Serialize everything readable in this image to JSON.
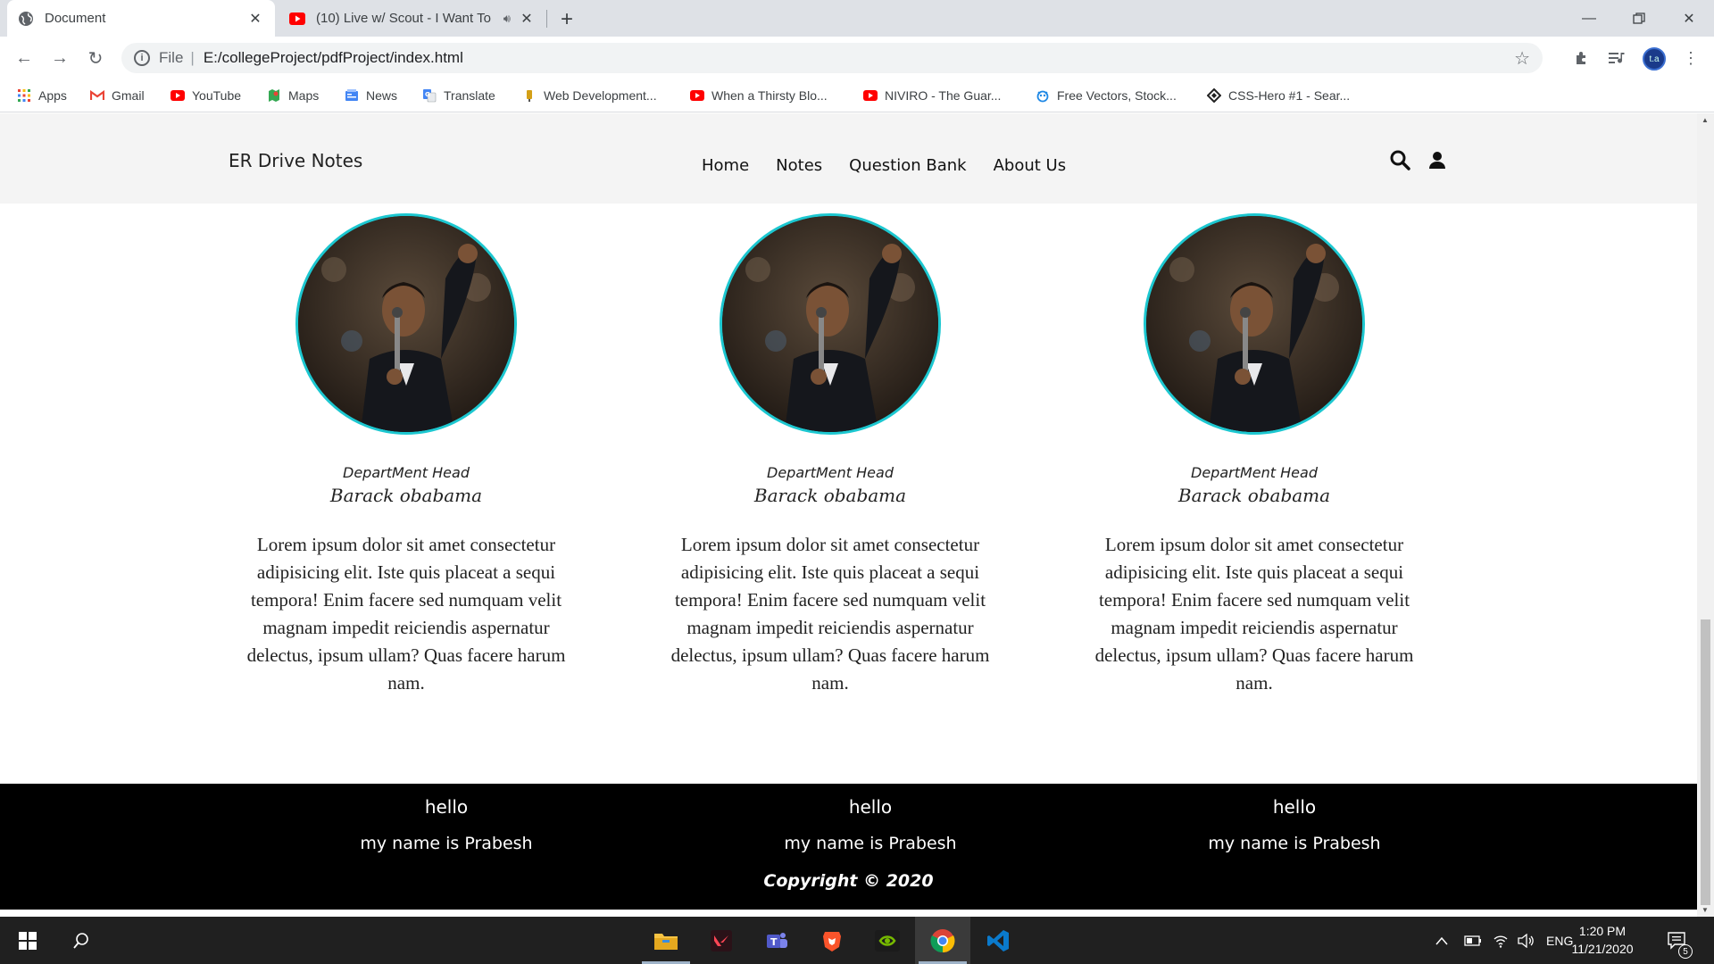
{
  "browser": {
    "tabs": [
      {
        "title": "Document",
        "active": true
      },
      {
        "title": "(10) Live w/ Scout - I Want To",
        "active": false
      }
    ],
    "url_scheme": "File",
    "url": "E:/collegeProject/pdfProject/index.html",
    "bookmarks": [
      {
        "label": "Apps",
        "icon": "apps-grid-icon"
      },
      {
        "label": "Gmail",
        "icon": "gmail-icon"
      },
      {
        "label": "YouTube",
        "icon": "youtube-icon"
      },
      {
        "label": "Maps",
        "icon": "maps-icon"
      },
      {
        "label": "News",
        "icon": "news-icon"
      },
      {
        "label": "Translate",
        "icon": "translate-icon"
      },
      {
        "label": "Web Development...",
        "icon": "web-dev-icon"
      },
      {
        "label": "When a Thirsty Blo...",
        "icon": "youtube-icon"
      },
      {
        "label": "NIVIRO - The Guar...",
        "icon": "youtube-icon"
      },
      {
        "label": "Free Vectors, Stock...",
        "icon": "vectors-icon"
      },
      {
        "label": "CSS-Hero #1 - Sear...",
        "icon": "csshero-icon"
      }
    ],
    "profile_initials": "t.a"
  },
  "site": {
    "brand": "ER Drive Notes",
    "nav": [
      "Home",
      "Notes",
      "Question Bank",
      "About Us"
    ],
    "team": [
      {
        "role": "DepartMent Head",
        "name": "Barack obabama",
        "bio": "Lorem ipsum dolor sit amet consectetur adipisicing elit. Iste quis placeat a sequi tempora! Enim facere sed numquam velit magnam impedit reiciendis aspernatur delectus, ipsum ullam? Quas facere harum nam."
      },
      {
        "role": "DepartMent Head",
        "name": "Barack obabama",
        "bio": "Lorem ipsum dolor sit amet consectetur adipisicing elit. Iste quis placeat a sequi tempora! Enim facere sed numquam velit magnam impedit reiciendis aspernatur delectus, ipsum ullam? Quas facere harum nam."
      },
      {
        "role": "DepartMent Head",
        "name": "Barack obabama",
        "bio": "Lorem ipsum dolor sit amet consectetur adipisicing elit. Iste quis placeat a sequi tempora! Enim facere sed numquam velit magnam impedit reiciendis aspernatur delectus, ipsum ullam? Quas facere harum nam."
      }
    ],
    "footer": {
      "columns": [
        {
          "heading": "hello",
          "text": "my name is Prabesh"
        },
        {
          "heading": "hello",
          "text": "my name is Prabesh"
        },
        {
          "heading": "hello",
          "text": "my name is Prabesh"
        }
      ],
      "copyright": "Copyright © 2020"
    }
  },
  "taskbar": {
    "language": "ENG",
    "time": "1:20 PM",
    "date": "11/21/2020",
    "notifications": "5"
  },
  "colors": {
    "portrait_border": "#1cc7d0",
    "header_bg": "#f4f4f4",
    "footer_bg": "#000000",
    "taskbar_bg": "#202020"
  }
}
